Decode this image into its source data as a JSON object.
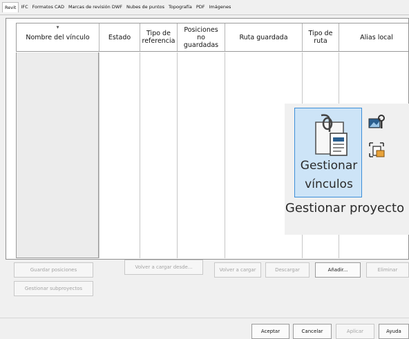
{
  "tabs": [
    {
      "label": "Revit",
      "active": true
    },
    {
      "label": "IFC",
      "active": false
    },
    {
      "label": "Formatos CAD",
      "active": false
    },
    {
      "label": "Marcas de revisión DWF",
      "active": false
    },
    {
      "label": "Nubes de puntos",
      "active": false
    },
    {
      "label": "Topografía",
      "active": false
    },
    {
      "label": "PDF",
      "active": false
    },
    {
      "label": "Imágenes",
      "active": false
    }
  ],
  "table": {
    "columns": [
      "Nombre del vínculo",
      "Estado",
      "Tipo de referencia",
      "Posiciones no guardadas",
      "Ruta guardada",
      "Tipo de ruta",
      "Alias local"
    ],
    "rows": []
  },
  "buttons": {
    "guardar_posiciones": "Guardar posiciones",
    "volver_cargar_desde": "Volver a cargar desde...",
    "volver_cargar": "Volver a cargar",
    "descargar": "Descargar",
    "anadir": "Añadir...",
    "eliminar": "Eliminar",
    "gestionar_subproyectos": "Gestionar subproyectos"
  },
  "footer": {
    "aceptar": "Aceptar",
    "cancelar": "Cancelar",
    "aplicar": "Aplicar",
    "ayuda": "Ayuda"
  },
  "ribbon_popup": {
    "big_button_line1": "Gestionar",
    "big_button_line2": "vínculos",
    "panel_caption": "Gestionar proyecto",
    "highlight_color": "#cde4f7",
    "border_color": "#3c8ed8",
    "icons": [
      "manage-links-icon",
      "manage-images-icon",
      "starting-view-icon"
    ]
  }
}
